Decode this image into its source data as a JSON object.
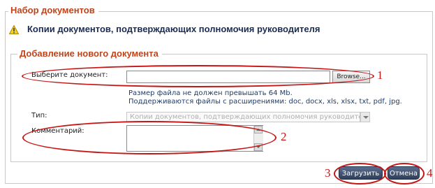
{
  "section_title": "Набор документов",
  "warning": {
    "icon": "warning-icon",
    "text": "Копии документов, подтверждающих полномочия руководителя"
  },
  "subsection_title": "Добавление нового документа",
  "form": {
    "document_label": "Выберите документ:",
    "document_value": "",
    "browse_label": "Browse...",
    "hint_size": "Размер файла не должен превышать 64 Mb.",
    "hint_extensions": "Поддерживаются файлы с расширениями: doc, docx, xls, xlsx, txt, pdf, jpg.",
    "type_label": "Тип:",
    "type_value": "Копии документов, подтверждающих полномочия руководителя",
    "comment_label": "Комментарий:",
    "comment_value": ""
  },
  "buttons": {
    "upload": "Загрузить",
    "cancel": "Отмена"
  },
  "annotations": {
    "n1": "1",
    "n2": "2",
    "n3": "3",
    "n4": "4",
    "color": "#c61515"
  }
}
